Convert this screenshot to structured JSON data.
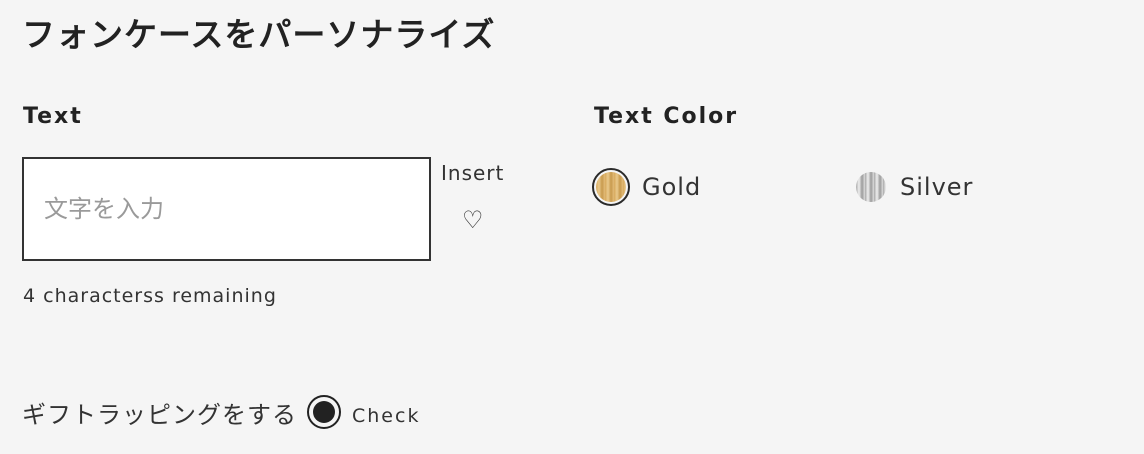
{
  "header": {
    "title": "フォンケースをパーソナライズ"
  },
  "text_section": {
    "label": "Text",
    "input_placeholder": "文字を入力",
    "input_value": "",
    "insert_label": "Insert",
    "heart_symbol": "♡",
    "chars_remaining": "4 characterss remaining"
  },
  "color_section": {
    "label": "Text Color",
    "options": [
      {
        "name": "Gold",
        "selected": true,
        "color": "#d7a95c"
      },
      {
        "name": "Silver",
        "selected": false,
        "color": "#bdbdbd"
      }
    ]
  },
  "gift": {
    "label": "ギフトラッピングをする",
    "check_label": "Check",
    "checked": true
  }
}
